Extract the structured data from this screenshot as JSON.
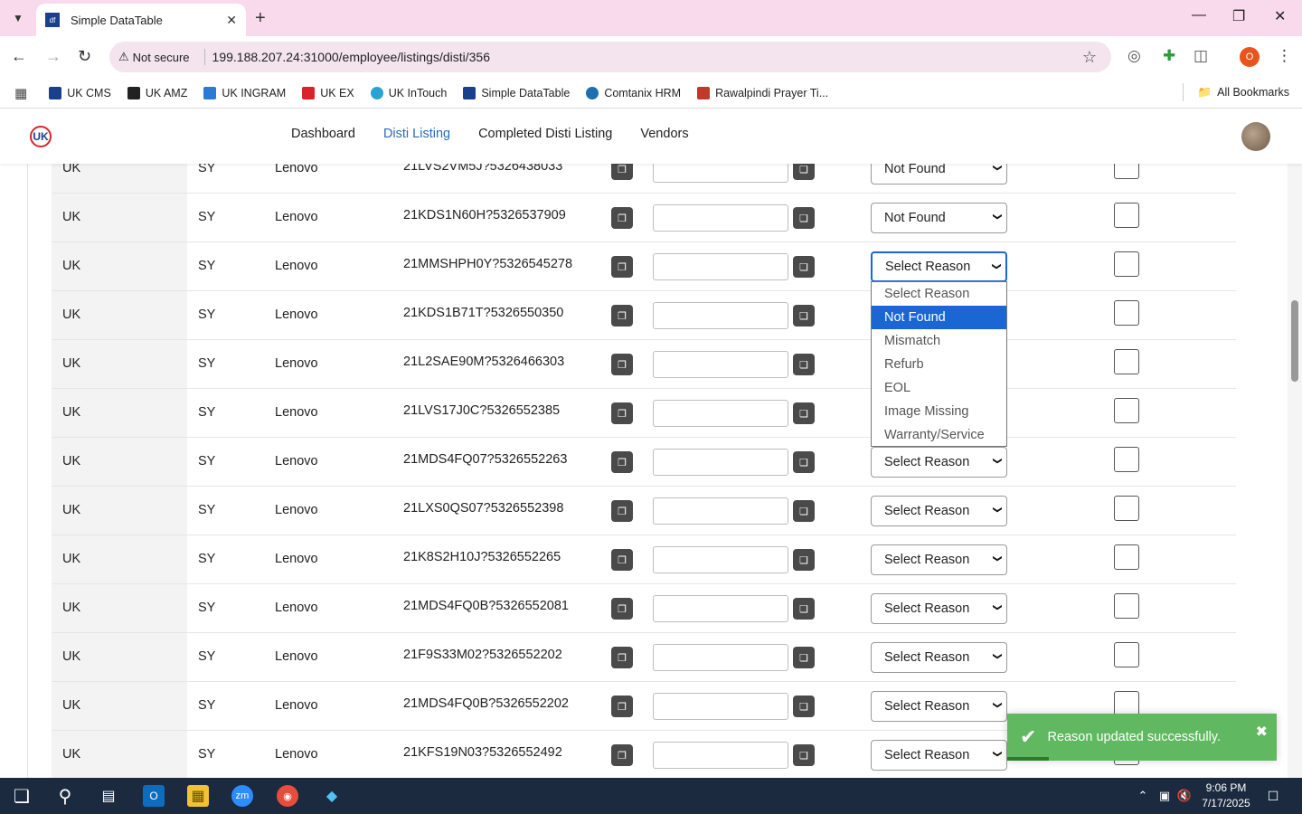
{
  "browser": {
    "tab_title": "Simple DataTable",
    "url_warning": "Not secure",
    "url": "199.188.207.24:31000/employee/listings/disti/356",
    "profile_initial": "O",
    "bookmarks": [
      {
        "label": "UK CMS",
        "color": "#1a3f8f"
      },
      {
        "label": "UK AMZ",
        "color": "#222222"
      },
      {
        "label": "UK INGRAM",
        "color": "#2a7ad6"
      },
      {
        "label": "UK EX",
        "color": "#d8232a"
      },
      {
        "label": "UK InTouch",
        "color": "#29a3d6"
      },
      {
        "label": "Simple DataTable",
        "color": "#1a3f8f"
      },
      {
        "label": "Comtanix HRM",
        "color": "#1f6fb0"
      },
      {
        "label": "Rawalpindi Prayer Ti...",
        "color": "#c0392b"
      }
    ],
    "all_bookmarks": "All Bookmarks"
  },
  "nav": {
    "logo": "UK",
    "items": [
      "Dashboard",
      "Disti Listing",
      "Completed Disti Listing",
      "Vendors"
    ],
    "active_index": 1
  },
  "rows": [
    {
      "country": "UK",
      "code": "SY",
      "vendor": "Lenovo",
      "sku": "21LVS2VM5J?5326438033",
      "reason": "Not Found"
    },
    {
      "country": "UK",
      "code": "SY",
      "vendor": "Lenovo",
      "sku": "21KDS1N60H?5326537909",
      "reason": "Not Found"
    },
    {
      "country": "UK",
      "code": "SY",
      "vendor": "Lenovo",
      "sku": "21MMSHPH0Y?5326545278",
      "reason": "Select Reason"
    },
    {
      "country": "UK",
      "code": "SY",
      "vendor": "Lenovo",
      "sku": "21KDS1B71T?5326550350",
      "reason": ""
    },
    {
      "country": "UK",
      "code": "SY",
      "vendor": "Lenovo",
      "sku": "21L2SAE90M?5326466303",
      "reason": ""
    },
    {
      "country": "UK",
      "code": "SY",
      "vendor": "Lenovo",
      "sku": "21LVS17J0C?5326552385",
      "reason": ""
    },
    {
      "country": "UK",
      "code": "SY",
      "vendor": "Lenovo",
      "sku": "21MDS4FQ07?5326552263",
      "reason": "Select Reason"
    },
    {
      "country": "UK",
      "code": "SY",
      "vendor": "Lenovo",
      "sku": "21LXS0QS07?5326552398",
      "reason": "Select Reason"
    },
    {
      "country": "UK",
      "code": "SY",
      "vendor": "Lenovo",
      "sku": "21K8S2H10J?5326552265",
      "reason": "Select Reason"
    },
    {
      "country": "UK",
      "code": "SY",
      "vendor": "Lenovo",
      "sku": "21MDS4FQ0B?5326552081",
      "reason": "Select Reason"
    },
    {
      "country": "UK",
      "code": "SY",
      "vendor": "Lenovo",
      "sku": "21F9S33M02?5326552202",
      "reason": "Select Reason"
    },
    {
      "country": "UK",
      "code": "SY",
      "vendor": "Lenovo",
      "sku": "21MDS4FQ0B?5326552202",
      "reason": "Select Reason"
    },
    {
      "country": "UK",
      "code": "SY",
      "vendor": "Lenovo",
      "sku": "21KFS19N03?5326552492",
      "reason": "Select Reason"
    }
  ],
  "dropdown": {
    "options": [
      "Select Reason",
      "Not Found",
      "Mismatch",
      "Refurb",
      "EOL",
      "Image Missing",
      "Warranty/Service"
    ],
    "highlighted_index": 1
  },
  "toast": {
    "message": "Reason updated successfully.",
    "color": "#60b860"
  },
  "taskbar": {
    "time": "9:06 PM",
    "date": "7/17/2025"
  }
}
